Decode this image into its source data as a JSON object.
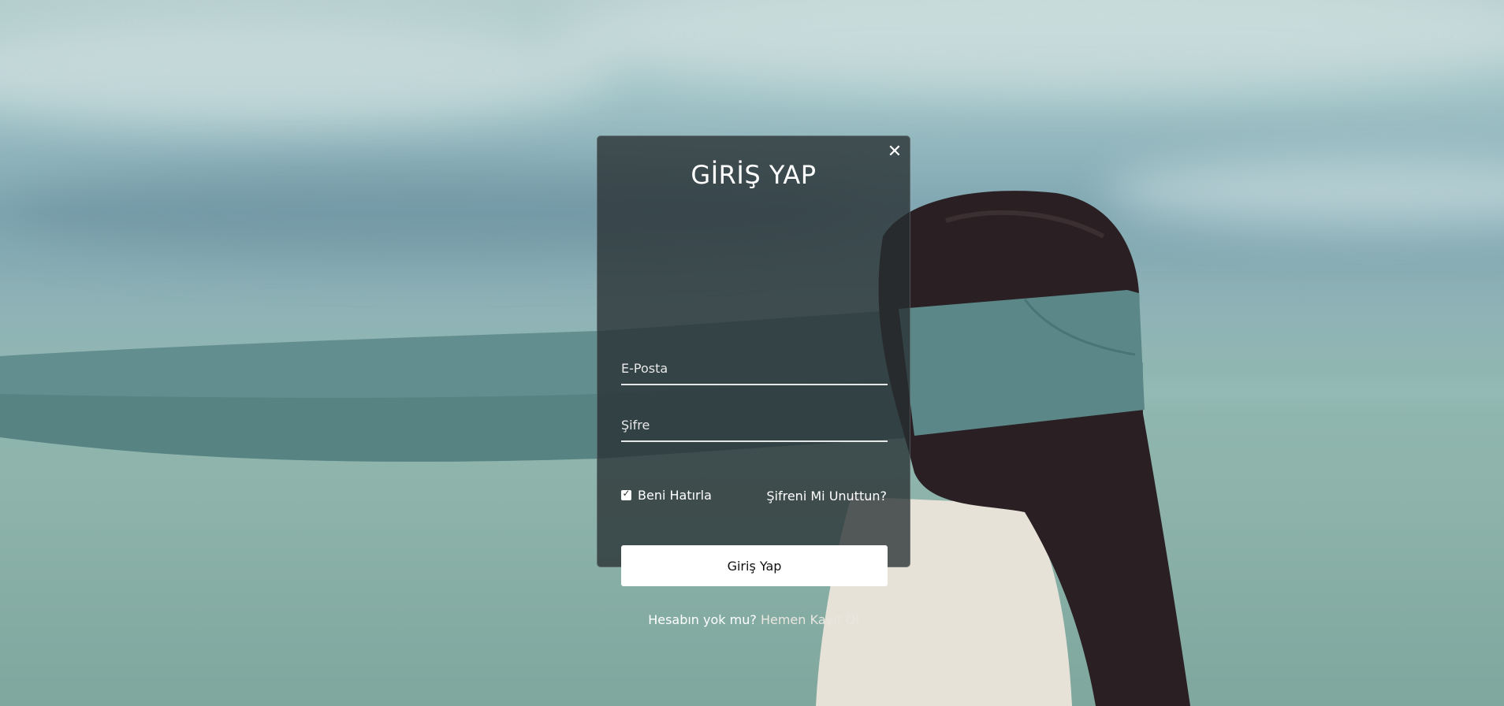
{
  "login_modal": {
    "title": "GİRİŞ YAP",
    "close_symbol": "✕",
    "email_placeholder": "E-Posta",
    "password_placeholder": "Şifre",
    "remember_label": "Beni Hatırla",
    "remember_checked": true,
    "forgot_link": "Şifreni Mi Unuttun?",
    "submit_label": "Giriş Yap",
    "signup_prompt": "Hesabın yok mu?",
    "signup_link": "Hemen Kayıt Ol"
  },
  "icons": {
    "close": "close-icon",
    "check": "check-icon"
  },
  "colors": {
    "modal_background": "#283032",
    "button_background": "#ffffff",
    "text": "#ffffff"
  }
}
